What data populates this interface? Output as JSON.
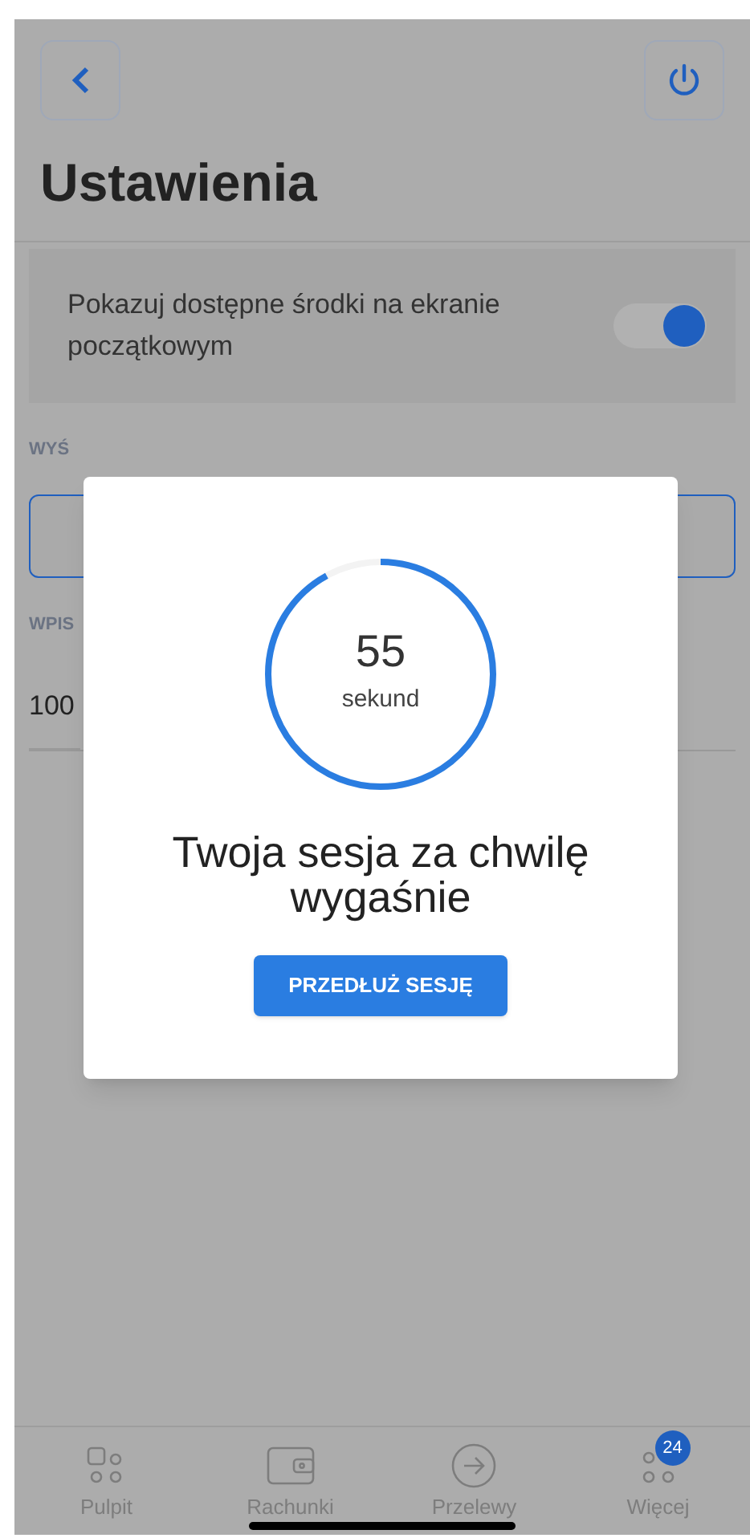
{
  "header": {
    "title": "Ustawienia"
  },
  "settings": [
    {
      "label": "Pokazuj dostępne środki na ekranie początkowym",
      "on": true
    }
  ],
  "sections": [
    {
      "label": "WYŚ",
      "kind": "select"
    },
    {
      "label": "WPIS",
      "kind": "input",
      "value": "100"
    }
  ],
  "nav": [
    {
      "label": "Pulpit",
      "kind": "grid"
    },
    {
      "label": "Rachunki",
      "kind": "wallet"
    },
    {
      "label": "Przelewy",
      "kind": "arrow"
    },
    {
      "label": "Więcej",
      "kind": "more",
      "badge": "24"
    }
  ],
  "session_modal": {
    "seconds": "55",
    "unit": "sekund",
    "level": 0.92,
    "message": "Twoja sesja za chwilę wygaśnie",
    "button": "PRZEDŁUŻ SESJĘ"
  }
}
